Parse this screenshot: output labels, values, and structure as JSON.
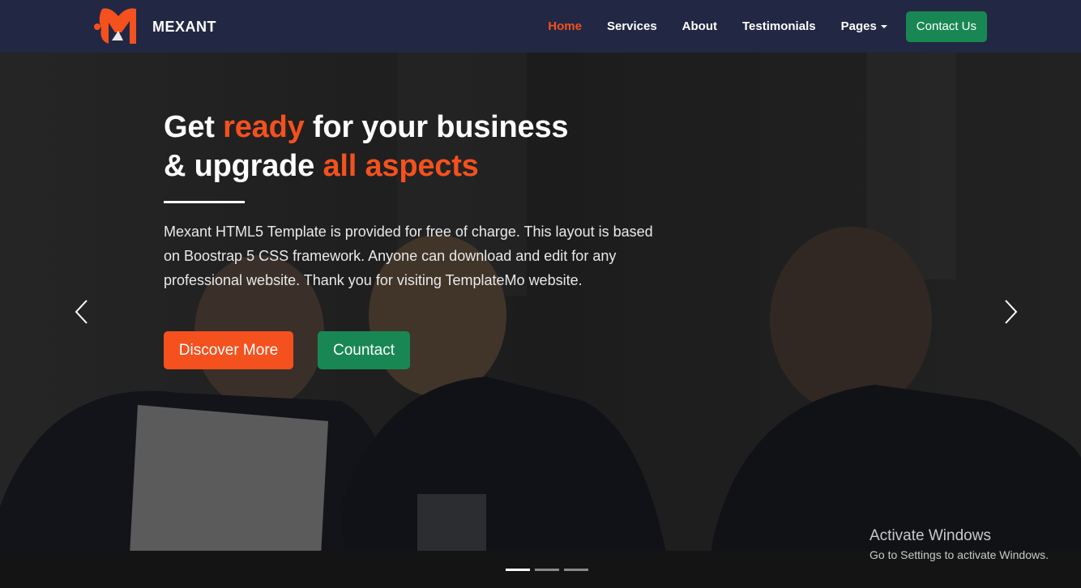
{
  "brand": {
    "name": "MEXANT",
    "logo_icon": "m-fish-logo",
    "color": "#f4511e"
  },
  "nav": {
    "items": [
      {
        "label": "Home",
        "active": true
      },
      {
        "label": "Services",
        "active": false
      },
      {
        "label": "About",
        "active": false
      },
      {
        "label": "Testimonials",
        "active": false
      },
      {
        "label": "Pages",
        "active": false,
        "dropdown": true
      }
    ],
    "contact_label": "Contact Us"
  },
  "hero": {
    "title": {
      "part1": "Get ",
      "accent1": "ready",
      "part2": " for your business",
      "part3": "& upgrade ",
      "accent2": "all aspects"
    },
    "description": "Mexant HTML5 Template is provided for free of charge. This layout is based on Boostrap 5 CSS framework. Anyone can download and edit for any professional website. Thank you for visiting TemplateMo website.",
    "primary_button": "Discover More",
    "secondary_button": "Countact",
    "prev_icon": "chevron-left-icon",
    "next_icon": "chevron-right-icon",
    "slides": 3,
    "active_slide": 1
  },
  "watermark": {
    "title": "Activate Windows",
    "subtitle": "Go to Settings to activate Windows."
  },
  "colors": {
    "navbar": "#222744",
    "accent": "#f4511e",
    "green": "#198754"
  }
}
